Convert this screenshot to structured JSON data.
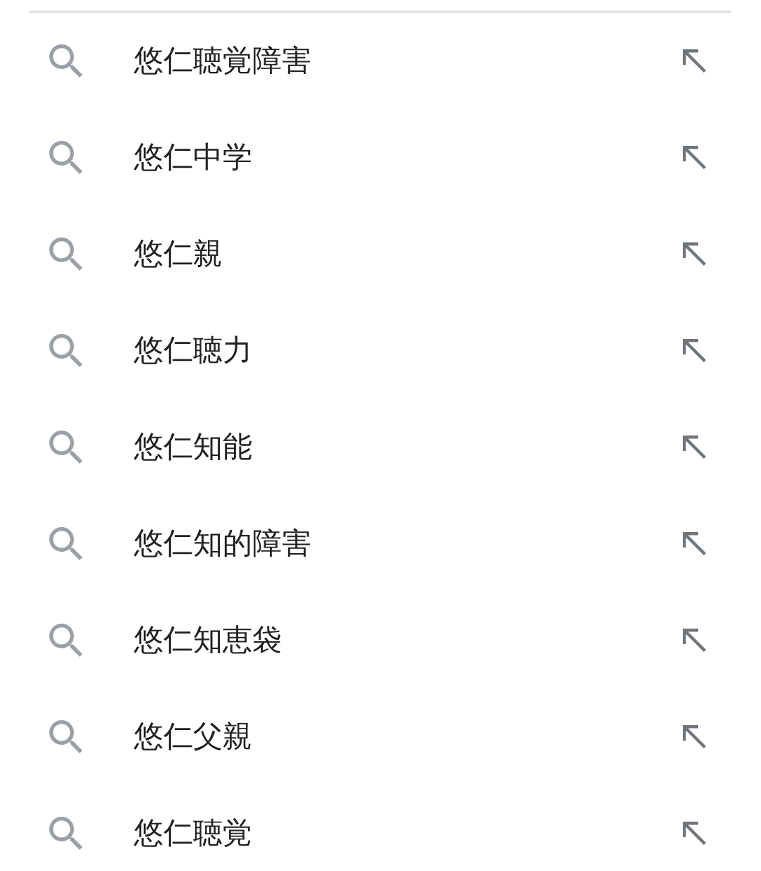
{
  "suggestions": [
    {
      "text": "悠仁聴覚障害"
    },
    {
      "text": "悠仁中学"
    },
    {
      "text": "悠仁親"
    },
    {
      "text": "悠仁聴力"
    },
    {
      "text": "悠仁知能"
    },
    {
      "text": "悠仁知的障害"
    },
    {
      "text": "悠仁知恵袋"
    },
    {
      "text": "悠仁父親"
    },
    {
      "text": "悠仁聴覚"
    }
  ]
}
